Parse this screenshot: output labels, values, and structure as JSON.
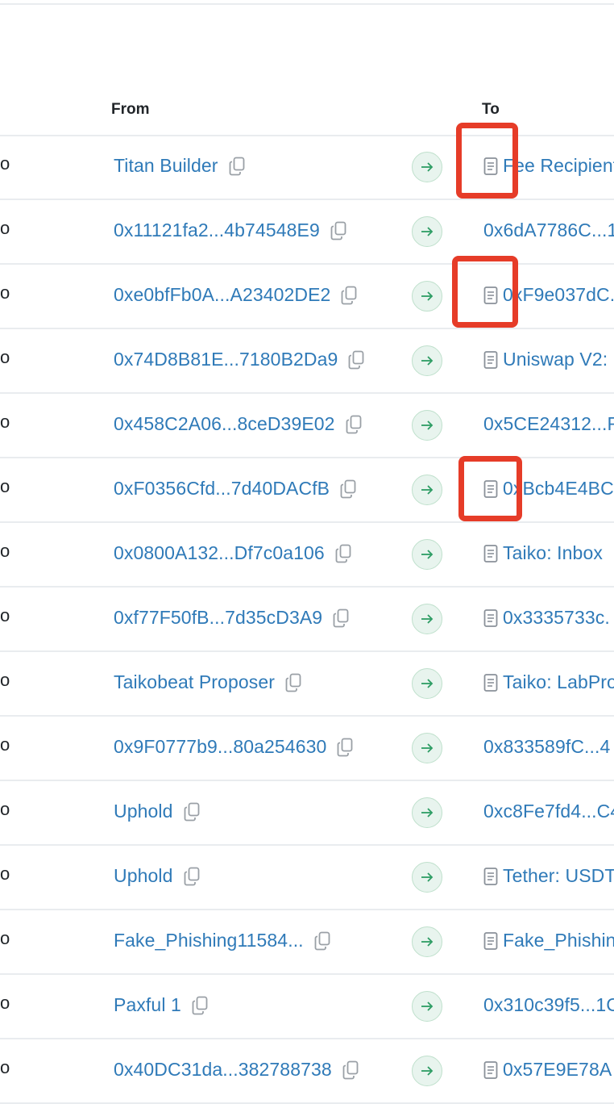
{
  "header": {
    "from": "From",
    "to": "To"
  },
  "highlight_color": "#e63c28",
  "rows": [
    {
      "cut": "o",
      "from": "Titan Builder",
      "to": "Fee Recipient",
      "to_is_contract": true
    },
    {
      "cut": "o",
      "from": "0x11121fa2...4b74548E9",
      "to": "0x6dA7786C...1",
      "to_is_contract": false
    },
    {
      "cut": "o",
      "from": "0xe0bfFb0A...A23402DE2",
      "to": "0xF9e037dC.",
      "to_is_contract": true
    },
    {
      "cut": "o",
      "from": "0x74D8B81E...7180B2Da9",
      "to": "Uniswap V2:",
      "to_is_contract": true
    },
    {
      "cut": "o",
      "from": "0x458C2A06...8ceD39E02",
      "to": "0x5CE24312...F",
      "to_is_contract": false
    },
    {
      "cut": "o",
      "from": "0xF0356Cfd...7d40DACfB",
      "to": "0xBcb4E4BC",
      "to_is_contract": true
    },
    {
      "cut": "o",
      "from": "0x0800A132...Df7c0a106",
      "to": "Taiko: Inbox",
      "to_is_contract": true
    },
    {
      "cut": "o",
      "from": "0xf77F50fB...7d35cD3A9",
      "to": "0x3335733c.",
      "to_is_contract": true
    },
    {
      "cut": "o",
      "from": "Taikobeat Proposer",
      "to": "Taiko: LabPro",
      "to_is_contract": true
    },
    {
      "cut": "o",
      "from": "0x9F0777b9...80a254630",
      "to": "0x833589fC...4",
      "to_is_contract": false
    },
    {
      "cut": "o",
      "from": "Uphold",
      "to": "0xc8Fe7fd4...C4",
      "to_is_contract": false
    },
    {
      "cut": "o",
      "from": "Uphold",
      "to": "Tether: USDT",
      "to_is_contract": true
    },
    {
      "cut": "o",
      "from": "Fake_Phishing11584...",
      "to": "Fake_Phishin",
      "to_is_contract": true
    },
    {
      "cut": "o",
      "from": "Paxful 1",
      "to": "0x310c39f5...1C",
      "to_is_contract": false
    },
    {
      "cut": "o",
      "from": "0x40DC31da...382788738",
      "to": "0x57E9E78A",
      "to_is_contract": true
    }
  ]
}
